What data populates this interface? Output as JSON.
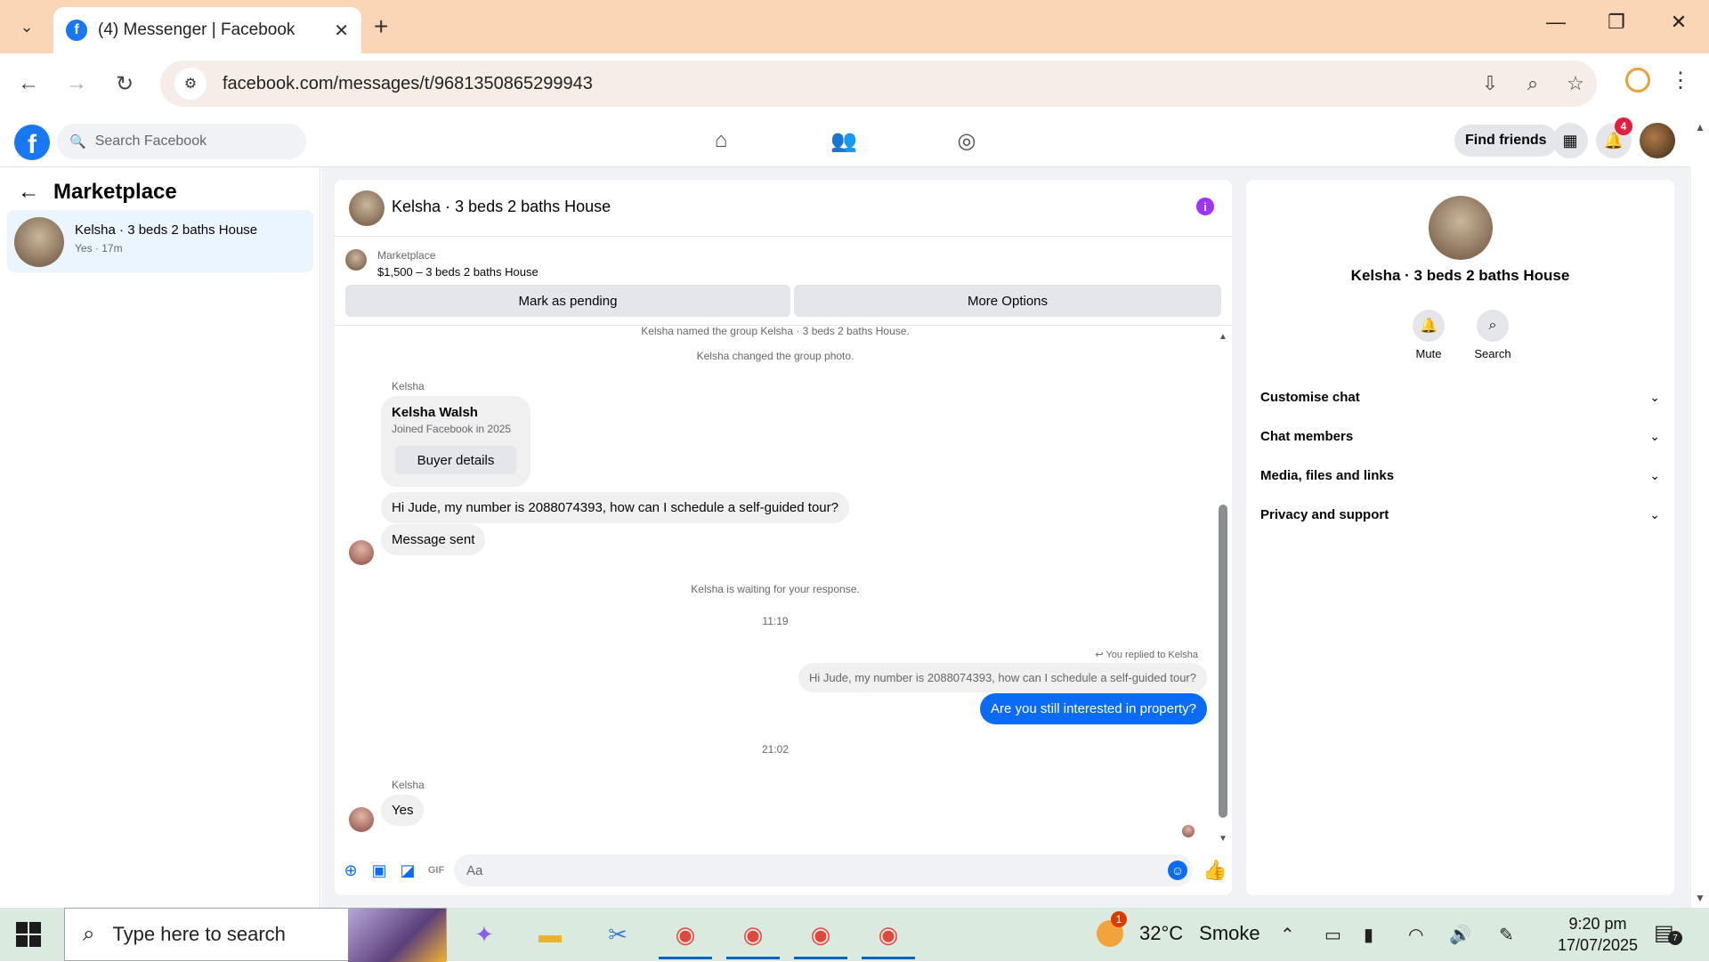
{
  "browser": {
    "tab_title": "(4) Messenger | Facebook",
    "url": "facebook.com/messages/t/9681350865299943"
  },
  "facebook": {
    "search_placeholder": "Search Facebook",
    "find_friends": "Find friends",
    "notification_count": "4",
    "brand_color": "#1877f2"
  },
  "left": {
    "title": "Marketplace",
    "conversations": [
      {
        "name": "Kelsha · 3 beds 2 baths House",
        "sub": "Yes · 17m"
      }
    ]
  },
  "chat": {
    "title": "Kelsha · 3 beds 2 baths House",
    "listing": {
      "source": "Marketplace",
      "price_title": "$1,500 – 3 beds 2 baths House",
      "btn_pending": "Mark as pending",
      "btn_more": "More Options"
    },
    "messages": {
      "sys1": "Kelsha named the group Kelsha · 3 beds 2 baths House.",
      "sys2": "Kelsha changed the group photo.",
      "sender1": "Kelsha",
      "card_name": "Kelsha Walsh",
      "card_sub": "Joined Facebook in 2025",
      "card_btn": "Buyer details",
      "msg1": "Hi Jude, my number is 2088074393, how can I schedule a self-guided tour?",
      "msg2": "Message sent",
      "sys3": "Kelsha is waiting for your response.",
      "time1": "11:19",
      "replied": "You replied to Kelsha",
      "quoted": "Hi Jude, my number is 2088074393, how can I schedule a self-guided tour?",
      "out1": "Are you still interested in property?",
      "time2": "21:02",
      "sender2": "Kelsha",
      "msg3": "Yes"
    },
    "composer_placeholder": "Aa",
    "accent": "#0a6cf5"
  },
  "right": {
    "name": "Kelsha · 3 beds 2 baths House",
    "actions": [
      {
        "label": "Mute"
      },
      {
        "label": "Search"
      }
    ],
    "sections": [
      {
        "label": "Customise chat"
      },
      {
        "label": "Chat members"
      },
      {
        "label": "Media, files and links"
      },
      {
        "label": "Privacy and support"
      }
    ]
  },
  "taskbar": {
    "search_text": "Type here to search",
    "temperature": "32°C",
    "weather": "Smoke",
    "weather_badge": "1",
    "time": "9:20 pm",
    "date": "17/07/2025",
    "notifications": "7"
  }
}
